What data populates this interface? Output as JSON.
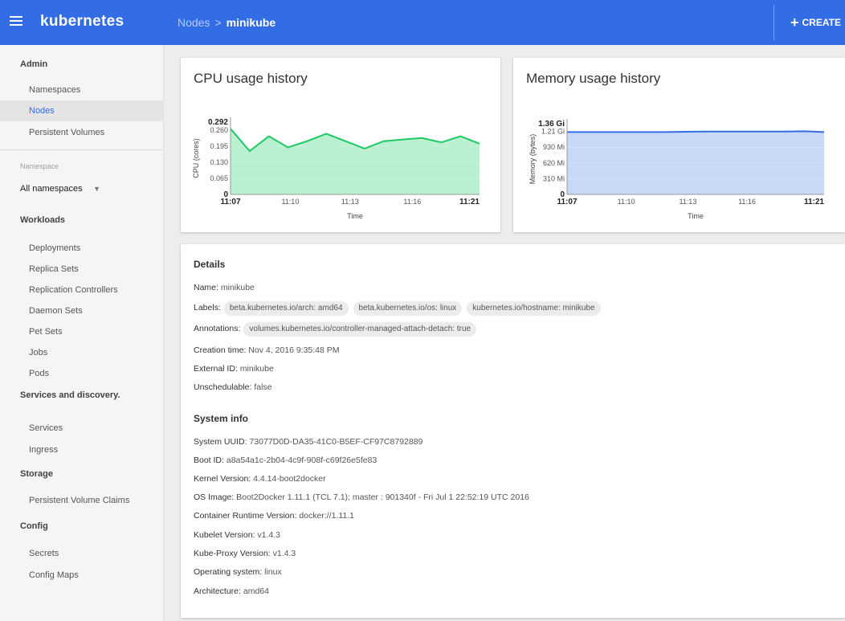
{
  "app": {
    "title": "kubernetes"
  },
  "breadcrumb": {
    "parent": "Nodes",
    "separator": ">",
    "current": "minikube"
  },
  "actions": {
    "create_label": "CREATE",
    "create_icon": "plus-icon"
  },
  "sidebar": {
    "admin": {
      "title": "Admin",
      "items": [
        "Namespaces",
        "Nodes",
        "Persistent Volumes"
      ],
      "active": "Nodes"
    },
    "namespace": {
      "label": "Namespace",
      "selected": "All namespaces"
    },
    "workloads": {
      "title": "Workloads",
      "items": [
        "Deployments",
        "Replica Sets",
        "Replication Controllers",
        "Daemon Sets",
        "Pet Sets",
        "Jobs",
        "Pods"
      ]
    },
    "services": {
      "title": "Services and discovery.",
      "items": [
        "Services",
        "Ingress"
      ]
    },
    "storage": {
      "title": "Storage",
      "items": [
        "Persistent Volume Claims"
      ]
    },
    "config": {
      "title": "Config",
      "items": [
        "Secrets",
        "Config Maps"
      ]
    }
  },
  "cpu_card": {
    "title": "CPU usage history"
  },
  "memory_card": {
    "title": "Memory usage history"
  },
  "chart_data": [
    {
      "type": "area",
      "ylabel": "CPU (cores)",
      "xlabel": "Time",
      "y_ticks": [
        "0",
        "0.065",
        "0.130",
        "0.195",
        "0.260",
        "0.292"
      ],
      "x_ticks": [
        "11:07",
        "11:10",
        "11:13",
        "11:16",
        "11:21"
      ],
      "x": [
        0,
        1,
        2,
        3,
        4,
        5,
        6,
        7,
        8,
        9,
        10,
        11,
        12,
        13
      ],
      "values": [
        0.265,
        0.175,
        0.235,
        0.19,
        0.215,
        0.245,
        0.215,
        0.185,
        0.215,
        0.222,
        0.228,
        0.21,
        0.235,
        0.205
      ],
      "ylim": [
        0,
        0.292
      ],
      "color": "#1ec963",
      "fill": "#b9f0cf"
    },
    {
      "type": "area",
      "ylabel": "Memory (bytes)",
      "xlabel": "Time",
      "y_ticks": [
        "0",
        "310 Mi",
        "620 Mi",
        "930 Mi",
        "1.21 Gi",
        "1.36 Gi"
      ],
      "x_ticks": [
        "11:07",
        "11:10",
        "11:13",
        "11:16",
        "11:21"
      ],
      "x": [
        0,
        1,
        2,
        3,
        4,
        5,
        6,
        7,
        8,
        9,
        10,
        11,
        12,
        13
      ],
      "values": [
        1.2,
        1.2,
        1.2,
        1.2,
        1.2,
        1.2,
        1.205,
        1.21,
        1.21,
        1.21,
        1.21,
        1.21,
        1.215,
        1.2
      ],
      "ylim": [
        0,
        1.36
      ],
      "color": "#326de6",
      "fill": "#c8d8f6"
    }
  ],
  "details": {
    "heading": "Details",
    "name": {
      "key": "Name:",
      "value": "minikube"
    },
    "labels": {
      "key": "Labels:",
      "chips": [
        "beta.kubernetes.io/arch: amd64",
        "beta.kubernetes.io/os: linux",
        "kubernetes.io/hostname: minikube"
      ]
    },
    "annotations": {
      "key": "Annotations:",
      "chips": [
        "volumes.kubernetes.io/controller-managed-attach-detach: true"
      ]
    },
    "creation_time": {
      "key": "Creation time:",
      "value": "Nov 4, 2016 9:35:48 PM"
    },
    "external_id": {
      "key": "External ID:",
      "value": "minikube"
    },
    "unschedulable": {
      "key": "Unschedulable:",
      "value": "false"
    }
  },
  "system_info": {
    "heading": "System info",
    "uuid": {
      "key": "System UUID:",
      "value": "73077D0D-DA35-41C0-B5EF-CF97C8792889"
    },
    "boot_id": {
      "key": "Boot ID:",
      "value": "a8a54a1c-2b04-4c9f-908f-c69f26e5fe83"
    },
    "kernel": {
      "key": "Kernel Version:",
      "value": "4.4.14-boot2docker"
    },
    "os_image": {
      "key": "OS Image:",
      "value": "Boot2Docker 1.11.1 (TCL 7.1); master : 901340f - Fri Jul 1 22:52:19 UTC 2016"
    },
    "runtime": {
      "key": "Container Runtime Version:",
      "value": "docker://1.11.1"
    },
    "kubelet": {
      "key": "Kubelet Version:",
      "value": "v1.4.3"
    },
    "kube_proxy": {
      "key": "Kube-Proxy Version:",
      "value": "v1.4.3"
    },
    "os": {
      "key": "Operating system:",
      "value": "linux"
    },
    "arch": {
      "key": "Architecture:",
      "value": "amd64"
    }
  }
}
